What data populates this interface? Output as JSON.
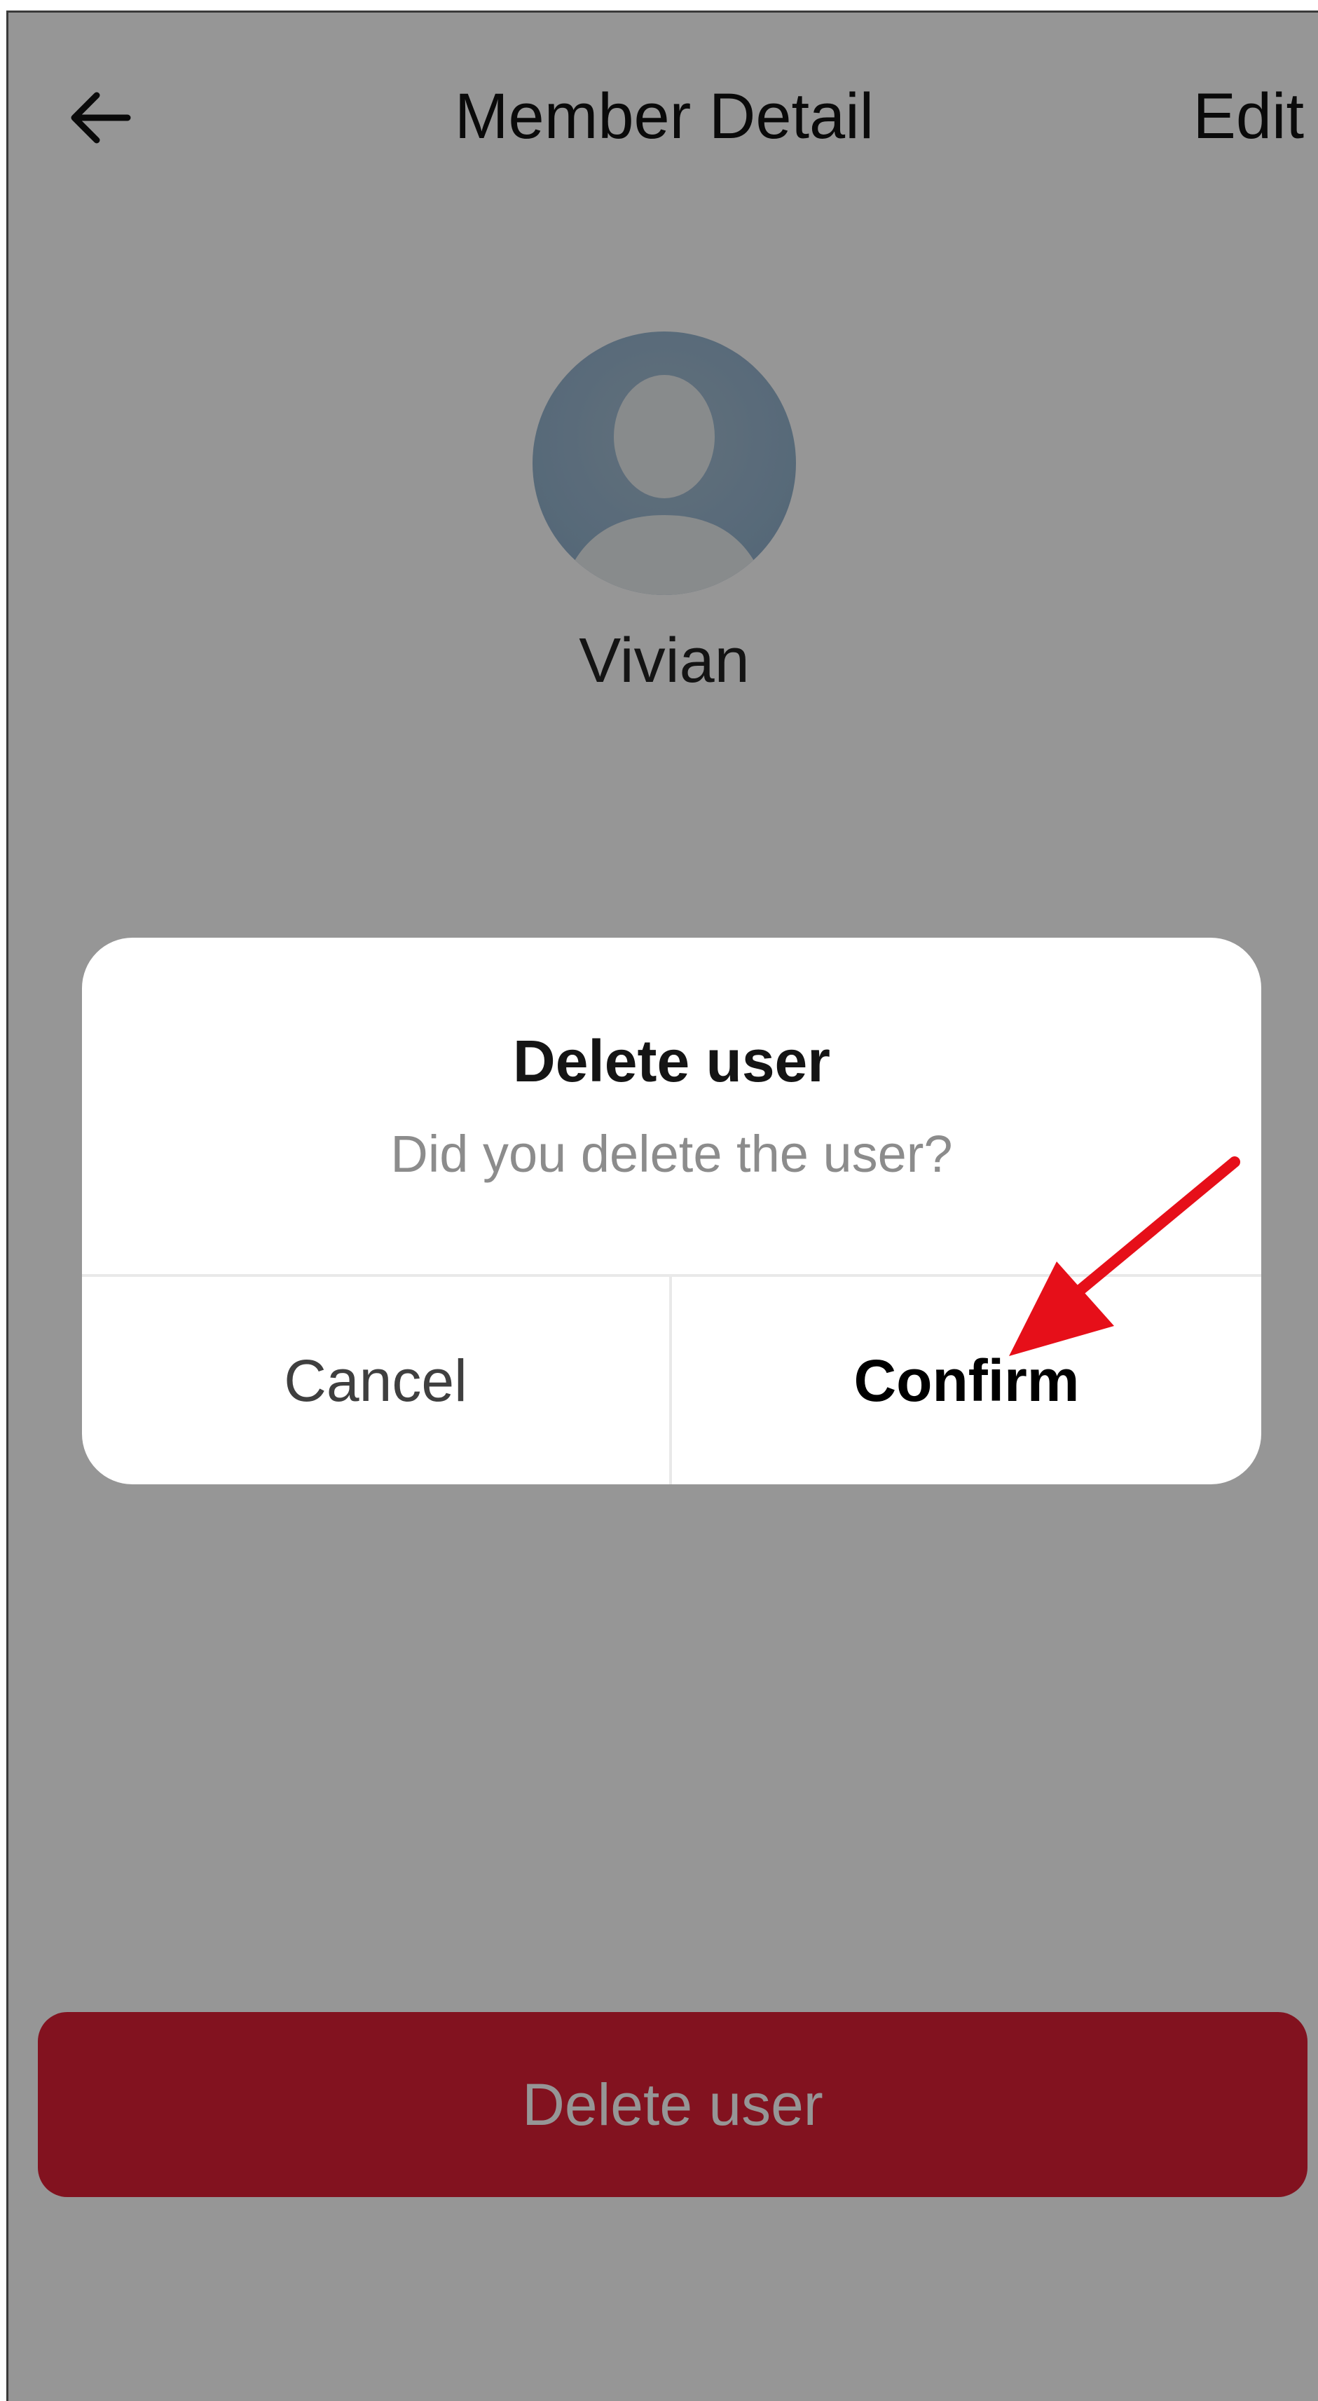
{
  "header": {
    "title": "Member Detail",
    "edit_label": "Edit",
    "back_icon": "arrow-left-icon"
  },
  "profile": {
    "name": "Vivian",
    "avatar_icon": "default-user-avatar"
  },
  "footer": {
    "delete_label": "Delete user"
  },
  "dialog": {
    "title": "Delete user",
    "message": "Did you delete the user?",
    "cancel_label": "Cancel",
    "confirm_label": "Confirm"
  },
  "colors": {
    "danger": "#dd1f35",
    "overlay": "rgba(0,0,0,0.41)",
    "annotation_arrow": "#e60f19"
  }
}
